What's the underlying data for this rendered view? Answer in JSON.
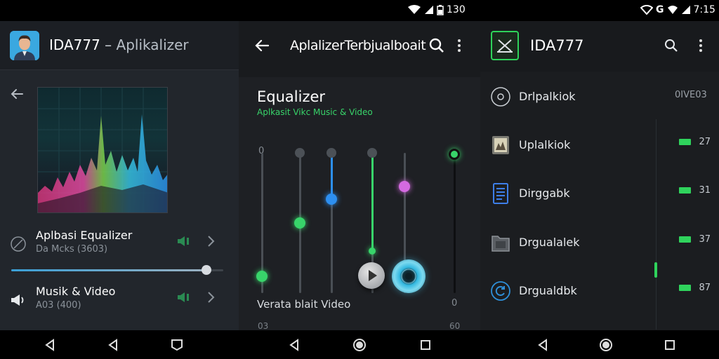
{
  "status_bar": {
    "left_time": "130",
    "right_time": "7:15"
  },
  "panel1": {
    "app_title": "IDA777",
    "app_title_separator": "–",
    "app_subtitle": "Aplikalizer",
    "rows": [
      {
        "title": "Aplbasi Equalizer",
        "subtitle": "Da Mcks (3603)"
      },
      {
        "title": "Musik & Video",
        "subtitle": "A03 (400)"
      }
    ],
    "seek_progress": 0.92
  },
  "panel2": {
    "app_title": "AplalizerTerbjualboait",
    "heading": "Equalizer",
    "subheading": "Aplkasit Vikc Music & Video",
    "axis_top": "0",
    "axis_bottom": "0",
    "footer_label": "Verata blait Video",
    "bottom_left": "03",
    "bottom_right": "60",
    "band_levels": [
      0.12,
      0.5,
      0.67,
      0.3,
      0.76,
      0.99
    ],
    "accent_green": "#38d46a",
    "accent_blue": "#2d8ff0",
    "accent_purple": "#d46ae0"
  },
  "panel3": {
    "app_title": "IDA777",
    "items": [
      {
        "label": "Drlpalkiok",
        "value": "0IVE03",
        "icon": "circle-disc-icon"
      },
      {
        "label": "Uplalkiok",
        "value": "27",
        "icon": "photo-album-icon"
      },
      {
        "label": "Dirggabk",
        "value": "31",
        "icon": "document-icon"
      },
      {
        "label": "Drgualalek",
        "value": "37",
        "icon": "folder-icon"
      },
      {
        "label": "Drgualdbk",
        "value": "87",
        "icon": "refresh-circle-icon"
      }
    ],
    "accent_green": "#2fd35c"
  }
}
